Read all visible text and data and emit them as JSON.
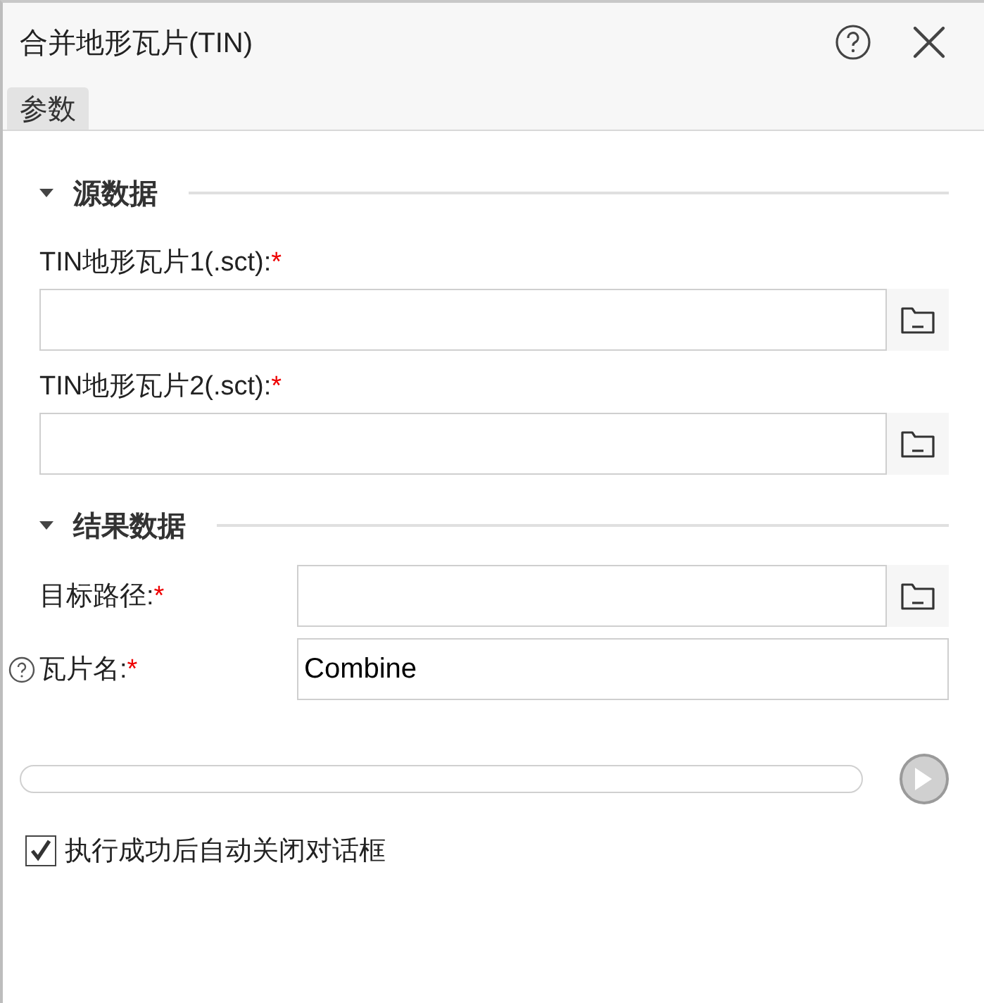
{
  "window": {
    "title": "合并地形瓦片(TIN)"
  },
  "tabs": [
    {
      "label": "参数",
      "selected": true
    }
  ],
  "sections": [
    {
      "title": "源数据",
      "expanded": true,
      "fields": [
        {
          "kind": "stacked",
          "label": "TIN地形瓦片1(.sct):",
          "required_mark": "*",
          "help": false,
          "browse": true
        },
        {
          "kind": "stacked",
          "label": "TIN地形瓦片2(.sct):",
          "required_mark": "*",
          "help": false,
          "browse": true
        }
      ]
    },
    {
      "title": "结果数据",
      "expanded": true,
      "fields": [
        {
          "kind": "inline",
          "label": "目标路径:",
          "required_mark": "*",
          "help": false,
          "browse": true
        },
        {
          "kind": "inline",
          "label": "瓦片名:",
          "required_mark": "*",
          "value": "Combine",
          "help": true,
          "browse": false
        }
      ]
    }
  ],
  "progress": {
    "level": 0
  },
  "close_option": {
    "label": "执行成功后自动关闭对话框",
    "checked": true
  }
}
